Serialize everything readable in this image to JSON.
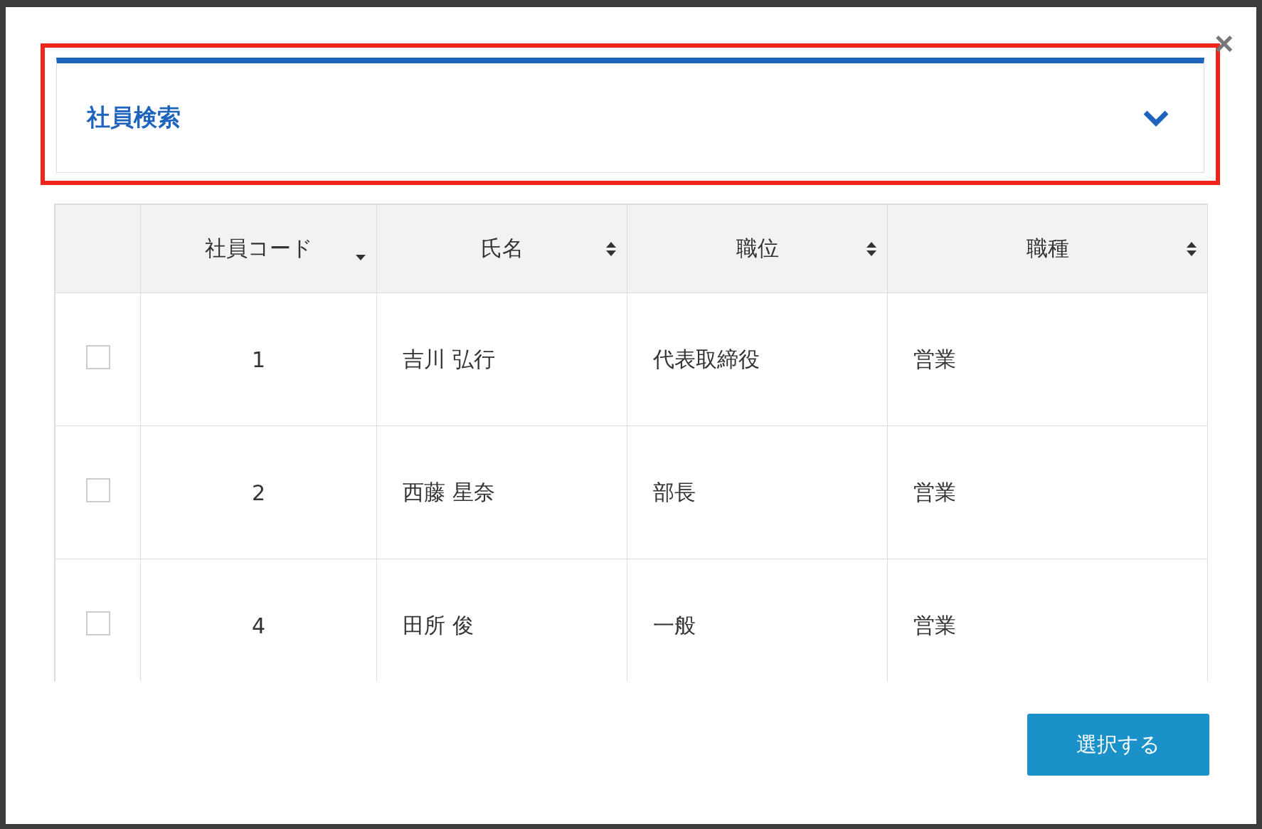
{
  "dialog": {
    "close_label": "×"
  },
  "search_panel": {
    "title": "社員検索",
    "expanded": false,
    "highlighted": true
  },
  "table": {
    "columns": [
      {
        "label": "社員コード",
        "sorted": true
      },
      {
        "label": "氏名",
        "sorted": false
      },
      {
        "label": "職位",
        "sorted": false
      },
      {
        "label": "職種",
        "sorted": false
      }
    ],
    "rows": [
      {
        "checked": false,
        "cells": [
          "1",
          "吉川 弘行",
          "代表取締役",
          "営業"
        ]
      },
      {
        "checked": false,
        "cells": [
          "2",
          "西藤 星奈",
          "部長",
          "営業"
        ]
      },
      {
        "checked": false,
        "cells": [
          "4",
          "田所 俊",
          "一般",
          "営業"
        ]
      }
    ]
  },
  "buttons": [
    {
      "label": "選択する"
    }
  ]
}
